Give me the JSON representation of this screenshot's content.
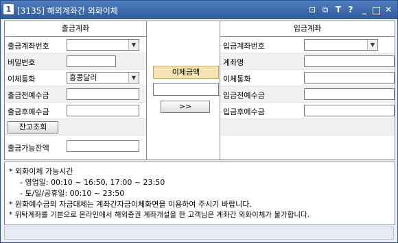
{
  "window": {
    "icon": "1",
    "title": "[3135] 해외계좌간 외화이체",
    "controls": {
      "pin": "⊡",
      "copy": "⧉",
      "font": "T",
      "help": "?",
      "minimize": "_",
      "close": "✕"
    }
  },
  "left": {
    "header": "출금계좌",
    "account_no_label": "출금계좌번호",
    "account_no_value": "",
    "password_label": "비밀번호",
    "password_value": "",
    "currency_label": "이체통화",
    "currency_value": "홍콩달러",
    "before_label": "출금전예수금",
    "before_value": "",
    "after_label": "출금후예수금",
    "after_value": "",
    "balance_button": "잔고조회",
    "available_label": "출금가능잔액",
    "available_value": ""
  },
  "middle": {
    "amount_label": "이체금액",
    "amount_value": "",
    "transfer_button": ">>"
  },
  "right": {
    "header": "입금계좌",
    "account_no_label": "입금계좌번호",
    "account_no_value": "",
    "account_name_label": "계좌명",
    "account_name_value": "",
    "currency_label": "이체통화",
    "currency_value": "",
    "before_label": "입금전예수금",
    "before_value": "",
    "after_label": "입금후예수금",
    "after_value": ""
  },
  "notice": {
    "lines": [
      "* 외화이체 가능시간",
      "- 영업일: 00:10 ~ 16:50, 17:00 ~ 23:50",
      "- 토/일/공휴일: 00:10 ~ 23:50",
      "* 원화예수금의 자금대체는 계좌간자금이체화면을 이용하여 주시기 바랍니다.",
      "* 위탁계좌를 기본으로 온라인에서 해외증권 계좌개설을 한 고객님은 계좌간 외화이체가 불가합니다."
    ]
  },
  "colors": {
    "titlebar": "#2f5a9b",
    "amount_label_bg": "#f7e2b3"
  }
}
